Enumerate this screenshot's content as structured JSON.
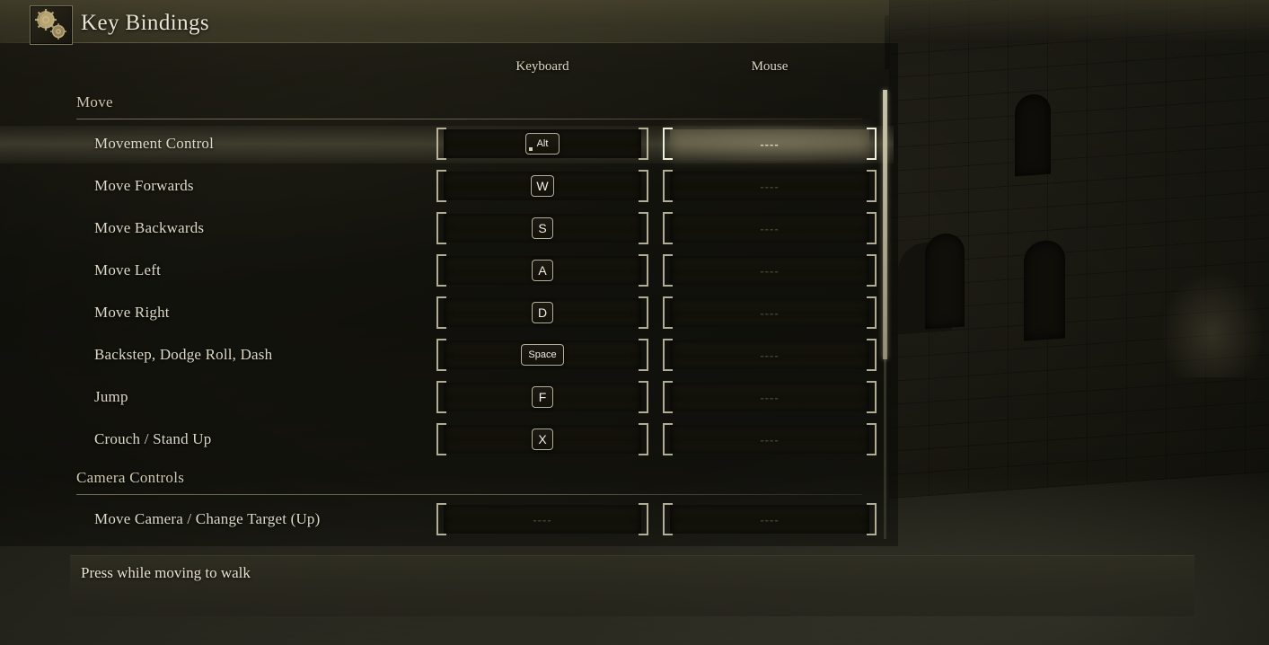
{
  "window": {
    "title": "Key Bindings",
    "icon": "gear-settings-icon"
  },
  "columns": {
    "keyboard": "Keyboard",
    "mouse": "Mouse"
  },
  "colors": {
    "text_primary": "#e6e1cf",
    "text_heading": "#cfc8ae",
    "bracket": "#d6d0b6",
    "selection_fill": "#968f70",
    "panel_bg": "#302f23"
  },
  "scroll": {
    "thumb_top_pct": 0,
    "thumb_height_pct": 60
  },
  "empty_value": "----",
  "sections": [
    {
      "name": "Move",
      "rows": [
        {
          "label": "Movement Control",
          "keyboard": {
            "type": "key",
            "key": "Alt",
            "style": "alt"
          },
          "mouse": {
            "type": "empty"
          },
          "selected": true,
          "selected_column": "mouse"
        },
        {
          "label": "Move Forwards",
          "keyboard": {
            "type": "key",
            "key": "W",
            "style": "char"
          },
          "mouse": {
            "type": "empty"
          },
          "selected": false
        },
        {
          "label": "Move Backwards",
          "keyboard": {
            "type": "key",
            "key": "S",
            "style": "char"
          },
          "mouse": {
            "type": "empty"
          },
          "selected": false
        },
        {
          "label": "Move Left",
          "keyboard": {
            "type": "key",
            "key": "A",
            "style": "char"
          },
          "mouse": {
            "type": "empty"
          },
          "selected": false
        },
        {
          "label": "Move Right",
          "keyboard": {
            "type": "key",
            "key": "D",
            "style": "char"
          },
          "mouse": {
            "type": "empty"
          },
          "selected": false
        },
        {
          "label": "Backstep, Dodge Roll, Dash",
          "keyboard": {
            "type": "key",
            "key": "Space",
            "style": "wide"
          },
          "mouse": {
            "type": "empty"
          },
          "selected": false
        },
        {
          "label": "Jump",
          "keyboard": {
            "type": "key",
            "key": "F",
            "style": "char"
          },
          "mouse": {
            "type": "empty"
          },
          "selected": false
        },
        {
          "label": "Crouch / Stand Up",
          "keyboard": {
            "type": "key",
            "key": "X",
            "style": "char"
          },
          "mouse": {
            "type": "empty"
          },
          "selected": false
        }
      ]
    },
    {
      "name": "Camera Controls",
      "rows": [
        {
          "label": "Move Camera / Change Target (Up)",
          "keyboard": {
            "type": "empty"
          },
          "mouse": {
            "type": "empty"
          },
          "selected": false
        }
      ]
    }
  ],
  "description": {
    "text": "Press while moving to walk"
  }
}
